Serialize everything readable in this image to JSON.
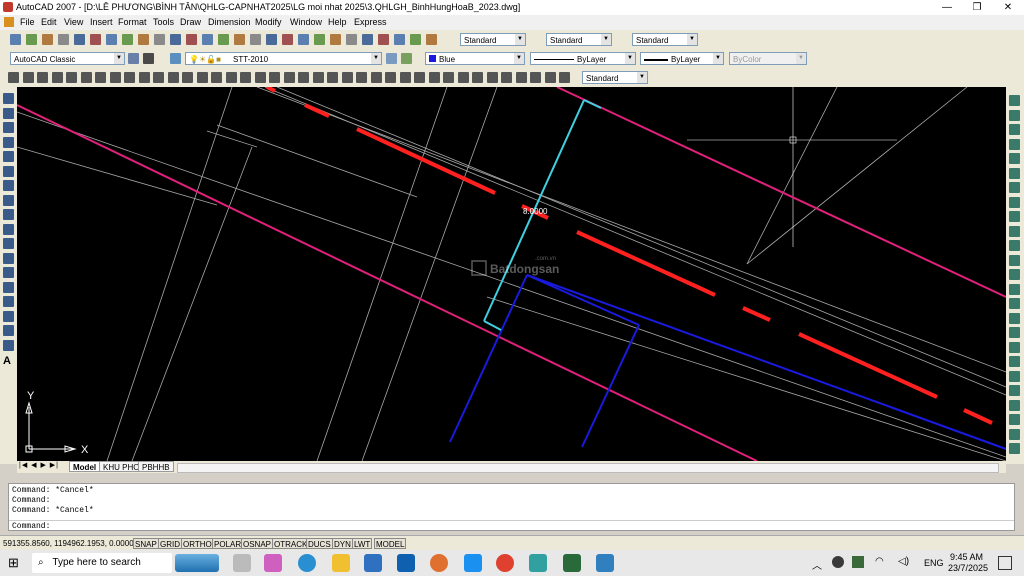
{
  "window": {
    "title": "AutoCAD 2007 - [D:\\LÊ PHƯƠNG\\BÌNH TÂN\\QHLG-CAPNHAT2025\\LG moi nhat 2025\\3.QHLGH_BinhHungHoaB_2023.dwg]",
    "minimize": "—",
    "maximize": "❐",
    "close": "✕"
  },
  "menu": [
    "File",
    "Edit",
    "View",
    "Insert",
    "Format",
    "Tools",
    "Draw",
    "Dimension",
    "Modify",
    "Window",
    "Help",
    "Express"
  ],
  "styles_toolbar": {
    "text_style": "Standard",
    "dim_style": "Standard",
    "table_style": "Standard"
  },
  "workspace": "AutoCAD Classic",
  "layer": "STT-2010",
  "properties": {
    "color": "Blue",
    "linetype": "ByLayer",
    "lineweight": "ByLayer",
    "plotstyle": "ByColor"
  },
  "dim_toolbar": {
    "dim_style": "Standard"
  },
  "drawing": {
    "dimension_text": "8.0000",
    "watermark": "Batdongsan",
    "watermark_sub": ".com.vn",
    "ucs_x": "X",
    "ucs_y": "Y",
    "colors": {
      "red": "#ff2020",
      "magenta": "#e0207a",
      "blue": "#1a1adf",
      "cyan": "#40d0e0",
      "grey": "#a8a8a8"
    }
  },
  "layout_tabs": [
    "Model",
    "KHU PHO",
    "PBHHB"
  ],
  "command_lines": [
    "Command: *Cancel*",
    "Command:",
    "Command: *Cancel*"
  ],
  "command_prompt": "Command:",
  "coordinates": "591355.8560, 1194962.1953, 0.0000",
  "status_buttons": [
    "SNAP",
    "GRID",
    "ORTHO",
    "POLAR",
    "OSNAP",
    "OTRACK",
    "DUCS",
    "DYN",
    "LWT",
    "MODEL"
  ],
  "taskbar": {
    "search_placeholder": "Type here to search",
    "language": "ENG",
    "time": "9:45 AM",
    "date": "23/7/2025"
  }
}
